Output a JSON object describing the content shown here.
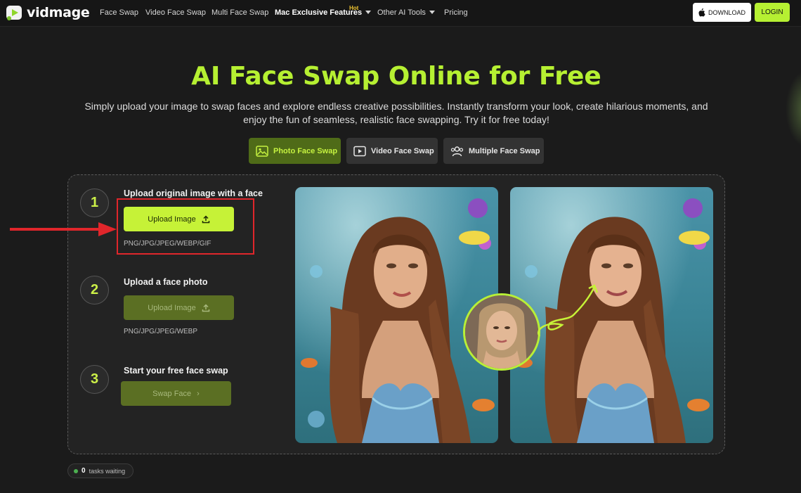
{
  "nav": {
    "brand": "vidmage",
    "items": [
      "Face Swap",
      "Video Face Swap",
      "Multi Face Swap",
      "Mac Exclusive Features",
      "Other AI Tools",
      "Pricing"
    ],
    "hot_badge": "Hot",
    "download_label": "DOWNLOAD",
    "login_label": "LOGIN"
  },
  "hero": {
    "title": "AI Face Swap Online for Free",
    "subtitle": "Simply upload your image to swap faces and explore endless creative possibilities. Instantly transform your look, create hilarious moments, and enjoy the fun of seamless, realistic face swapping. Try it for free today!"
  },
  "tabs": [
    {
      "label": "Photo Face Swap",
      "icon": "image-icon",
      "active": true
    },
    {
      "label": "Video Face Swap",
      "icon": "video-icon",
      "active": false
    },
    {
      "label": "Multiple Face Swap",
      "icon": "users-icon",
      "active": false
    }
  ],
  "steps": [
    {
      "number": "1",
      "title": "Upload original image with a face",
      "button": "Upload Image",
      "formats": "PNG/JPG/JPEG/WEBP/GIF"
    },
    {
      "number": "2",
      "title": "Upload a face photo",
      "button": "Upload Image",
      "formats": "PNG/JPG/JPEG/WEBP"
    },
    {
      "number": "3",
      "title": "Start your free face swap",
      "button": "Swap Face"
    }
  ],
  "tasks": {
    "count": "0",
    "label": "tasks waiting"
  },
  "colors": {
    "accent": "#b6f032",
    "highlight": "#e0262b",
    "background": "#1b1b1b"
  }
}
